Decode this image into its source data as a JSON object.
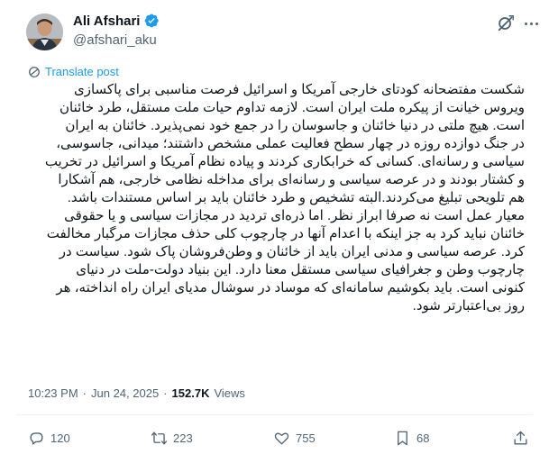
{
  "author": {
    "display_name": "Ali Afshari",
    "handle": "@afshari_aku"
  },
  "translate_label": "Translate post",
  "tweet_lines": [
    "شکست مفتضحانه کودتای خارجی آمریکا و اسرائیل فرصت مناسبی برای پاکسازی",
    "ویروس خیانت از پیکره ملت ایران است. لازمه تداوم حیات ملت مستقل، طرد خائنان",
    "است. هیچ ملتی در دنیا خائنان و جاسوسان را در جمع خود نمی‌پذیرد. خائنان به ایران",
    "در جنگ دوازده روزه در چهار سطح فعالیت عملی مشخص داشتند؛ میدانی، جاسوسی،",
    "سیاسی و رسانه‌ای. کسانی که خرابکاری کردند و پیاده نظام آمریکا و اسرائیل در تخریب",
    "و کشتار بودند و در عرصه سیاسی و رسانه‌ای برای مداخله نظامی خارجی، هم آشکارا",
    "هم تلویحی تبلیغ می‌کردند.البته تشخیص و طرد خائنان باید بر اساس مستندات باشد.",
    "معیار عمل است نه صرفا ابراز نظر. اما ذره‌ای تردید در مجازات سیاسی و یا حقوقی",
    "خائنان نباید کرد به جز اینکه با اعدام آنها در چارچوب کلی حذف مجازات مرگبار مخالفت",
    "کرد. عرصه سیاسی و مدنی ایران باید از خائنان و وطن‌فروشان پاک شود. سیاست در",
    "چارچوب وطن و جغرافیای سیاسی مستقل معنا دارد. این بنیاد دولت-ملت در دنیای",
    "کنونی است. باید بکوشیم سامانه‌ای که موساد در سوشال مدیای ایران راه انداخته، هر",
    "روز بی‌اعتبارتر شود."
  ],
  "meta": {
    "time": "10:23 PM",
    "separator": "·",
    "date": "Jun 24, 2025",
    "views_count": "152.7K",
    "views_label": "Views"
  },
  "actions": {
    "replies": "120",
    "reposts": "223",
    "likes": "755",
    "bookmarks": "68"
  },
  "colors": {
    "accent": "#1d9bf0",
    "text_primary": "#0f1419",
    "text_secondary": "#536471",
    "divider": "#eff3f4"
  }
}
